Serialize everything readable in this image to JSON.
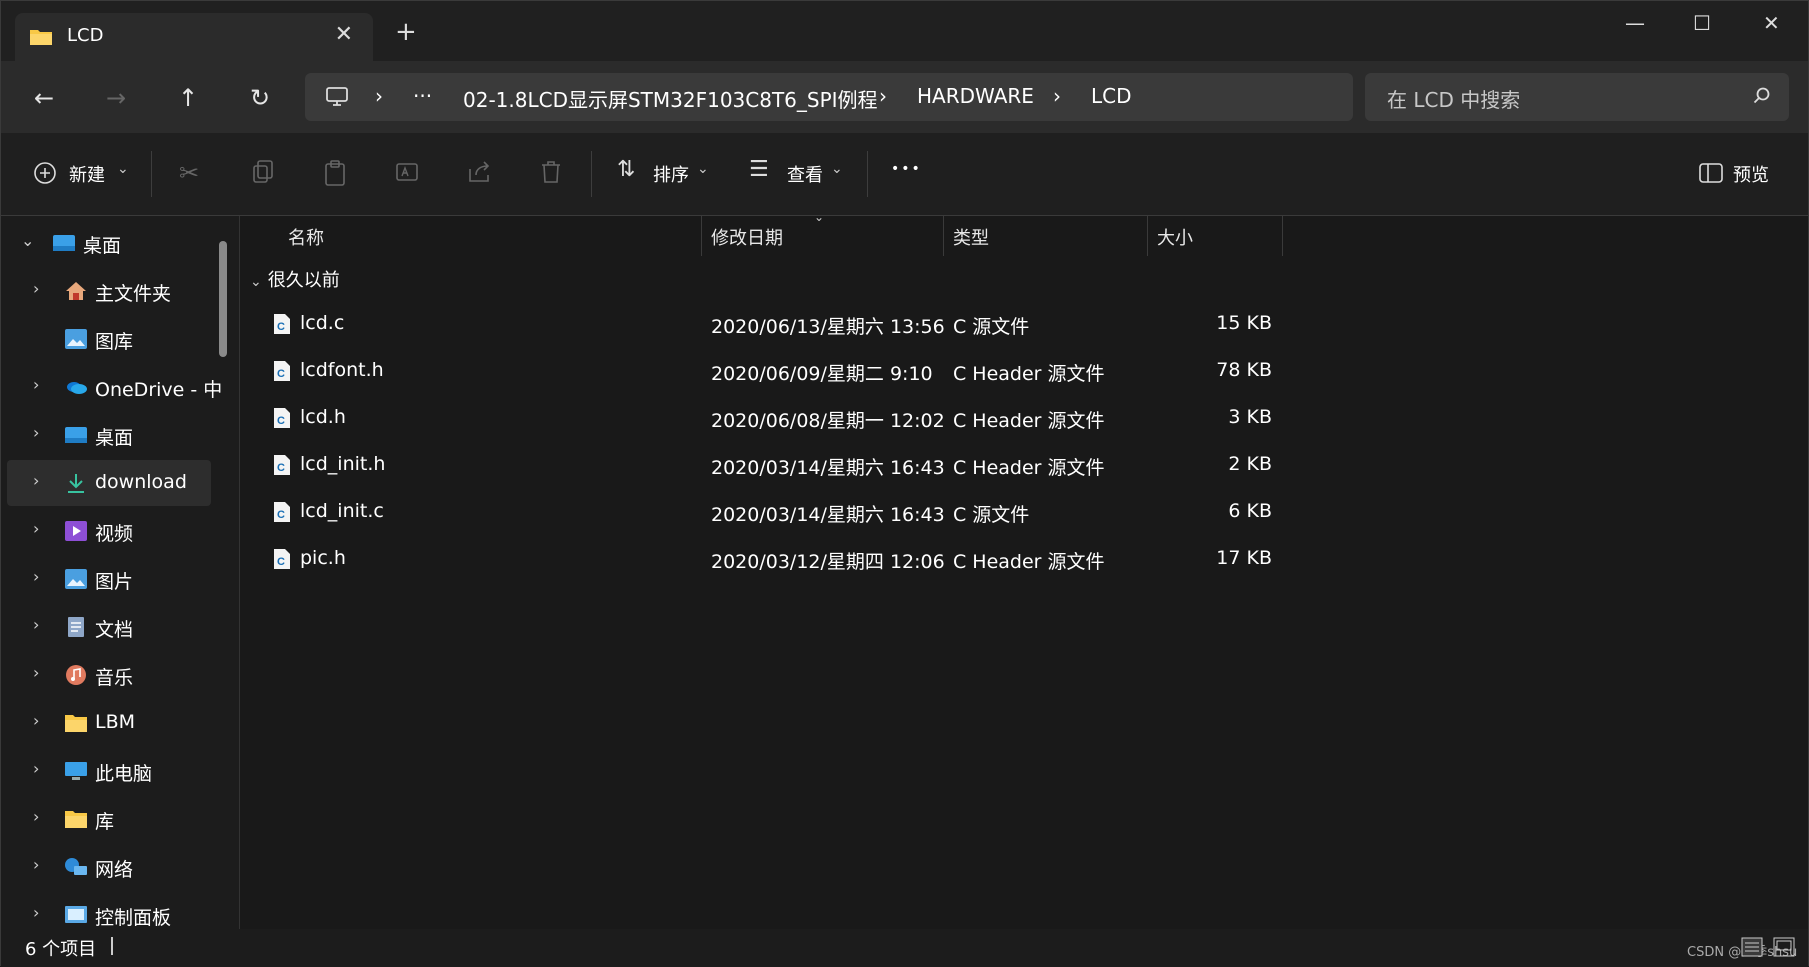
{
  "window": {
    "tab_title": "LCD"
  },
  "address": {
    "segments": [
      "02-1.8LCD显示屏STM32F103C8T6_SPI例程",
      "HARDWARE",
      "LCD"
    ],
    "overflow": "···"
  },
  "search": {
    "placeholder": "在 LCD 中搜索"
  },
  "toolbar": {
    "new_label": "新建",
    "sort_label": "排序",
    "view_label": "查看",
    "more": "•••",
    "preview_label": "预览"
  },
  "sidebar": {
    "items": [
      {
        "label": "桌面",
        "icon": "desktop-icon"
      },
      {
        "label": "主文件夹",
        "icon": "home-icon"
      },
      {
        "label": "图库",
        "icon": "gallery-icon"
      },
      {
        "label": "OneDrive - 中",
        "icon": "onedrive-icon"
      },
      {
        "label": "桌面",
        "icon": "desktop-icon"
      },
      {
        "label": "download",
        "icon": "download-icon"
      },
      {
        "label": "视频",
        "icon": "video-icon"
      },
      {
        "label": "图片",
        "icon": "pictures-icon"
      },
      {
        "label": "文档",
        "icon": "documents-icon"
      },
      {
        "label": "音乐",
        "icon": "music-icon"
      },
      {
        "label": "LBM",
        "icon": "folder-icon"
      },
      {
        "label": "此电脑",
        "icon": "computer-icon"
      },
      {
        "label": "库",
        "icon": "library-icon"
      },
      {
        "label": "网络",
        "icon": "network-icon"
      },
      {
        "label": "控制面板",
        "icon": "control-panel-icon"
      }
    ]
  },
  "columns": {
    "name": "名称",
    "modified": "修改日期",
    "type": "类型",
    "size": "大小"
  },
  "group_label": "很久以前",
  "files": [
    {
      "name": "lcd.c",
      "modified": "2020/06/13/星期六 13:56",
      "type": "C 源文件",
      "size": "15 KB"
    },
    {
      "name": "lcdfont.h",
      "modified": "2020/06/09/星期二 9:10",
      "type": "C Header 源文件",
      "size": "78 KB"
    },
    {
      "name": "lcd.h",
      "modified": "2020/06/08/星期一 12:02",
      "type": "C Header 源文件",
      "size": "3 KB"
    },
    {
      "name": "lcd_init.h",
      "modified": "2020/03/14/星期六 16:43",
      "type": "C Header 源文件",
      "size": "2 KB"
    },
    {
      "name": "lcd_init.c",
      "modified": "2020/03/14/星期六 16:43",
      "type": "C 源文件",
      "size": "6 KB"
    },
    {
      "name": "pic.h",
      "modified": "2020/03/12/星期四 12:06",
      "type": "C Header 源文件",
      "size": "17 KB"
    }
  ],
  "status": {
    "count": "6 个项目",
    "watermark": "CSDN @四季shsu"
  },
  "colors": {
    "accent": "#4cc2ff",
    "folder": "#f8c846",
    "bg": "#191919"
  }
}
